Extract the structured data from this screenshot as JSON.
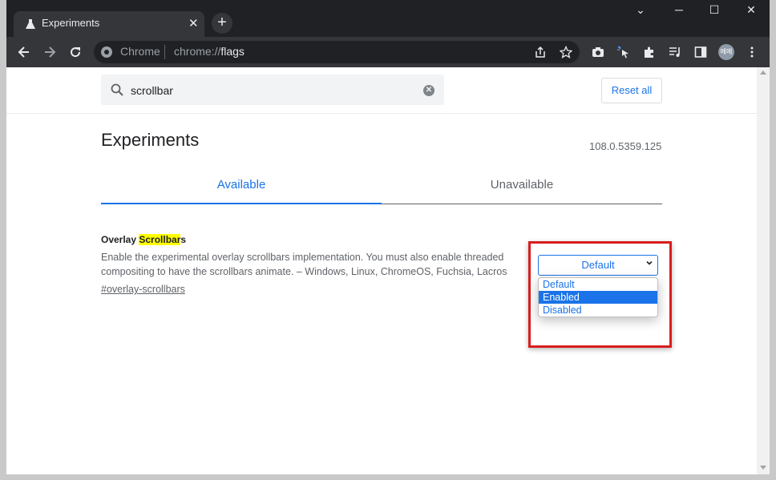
{
  "tab": {
    "title": "Experiments",
    "close": "✕"
  },
  "newtab": "+",
  "window_controls": {
    "minimize": "─",
    "maximize": "☐",
    "close": "✕",
    "tabsearch": "⌄"
  },
  "omnibox": {
    "origin": "Chrome",
    "url_prefix": "chrome://",
    "url_path": "flags"
  },
  "search": {
    "value": "scrollbar",
    "clear": "✕"
  },
  "reset_label": "Reset all",
  "page_title": "Experiments",
  "version": "108.0.5359.125",
  "tabs": {
    "available": "Available",
    "unavailable": "Unavailable"
  },
  "flag": {
    "name_prefix": "Overlay ",
    "name_highlight": "Scrollbar",
    "name_suffix": "s",
    "description": "Enable the experimental overlay scrollbars implementation. You must also enable threaded compositing to have the scrollbars animate. – Windows, Linux, ChromeOS, Fuchsia, Lacros",
    "link": "#overlay-scrollbars",
    "select_value": "Default",
    "options": [
      "Default",
      "Enabled",
      "Disabled"
    ],
    "highlighted_option": "Enabled"
  },
  "avatar_text": "메메",
  "colors": {
    "accent": "#1a73e8",
    "highlight": "#ffff00",
    "annotation": "#d81e1e",
    "chrome_dark": "#202124"
  }
}
